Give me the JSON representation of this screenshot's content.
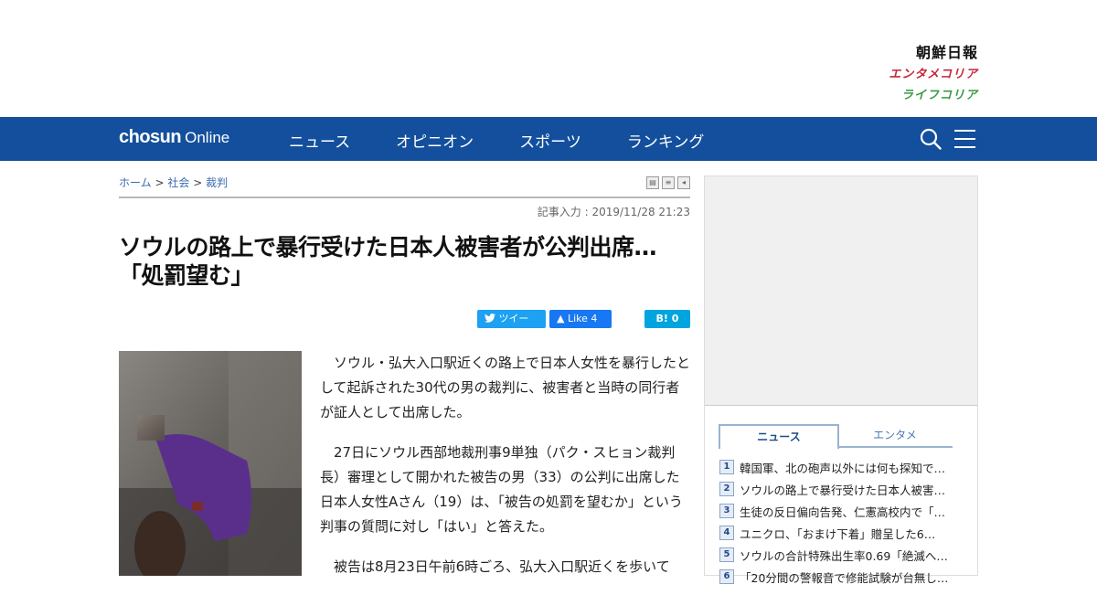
{
  "header": {
    "brand_newspaper": "朝鮮日報",
    "brand_entame": "エンタメコリア",
    "brand_life": "ライフコリア"
  },
  "nav": {
    "logo_bold": "chosun",
    "logo_light": "Online",
    "items": [
      "ニュース",
      "オピニオン",
      "スポーツ",
      "ランキング"
    ]
  },
  "breadcrumb": {
    "home": "ホーム",
    "sep": ">",
    "section": "社会",
    "subsection": "裁判"
  },
  "article": {
    "date": "記事入力 : 2019/11/28 21:23",
    "title": "ソウルの路上で暴行受けた日本人被害者が公判出席…「処罰望む」",
    "share": {
      "tweet": "ツイート",
      "like": "Like 4",
      "hatena": "B! 0"
    },
    "paragraphs": [
      "ソウル・弘大入口駅近くの路上で日本人女性を暴行したとして起訴された30代の男の裁判に、被害者と当時の同行者が証人として出席した。",
      "27日にソウル西部地裁刑事9単独（パク・スヒョン裁判長）審理として開かれた被告の男（33）の公判に出席した日本人女性Aさん（19）は、「被告の処罰を望むか」という判事の質問に対し「はい」と答えた。",
      "被告は8月23日午前6時ごろ、弘大入口駅近くを歩いて"
    ]
  },
  "sidebar": {
    "tabs": [
      "ニュース",
      "エンタメ"
    ],
    "ranking": [
      "韓国軍、北の砲声以外には何も探知で…",
      "ソウルの路上で暴行受けた日本人被害…",
      "生徒の反日偏向告発、仁憲高校内で「…",
      "ユニクロ、「おまけ下着」贈呈した6…",
      "ソウルの合計特殊出生率0.69「絶滅へ…",
      "「20分間の警報音で修能試験が台無し…"
    ]
  }
}
